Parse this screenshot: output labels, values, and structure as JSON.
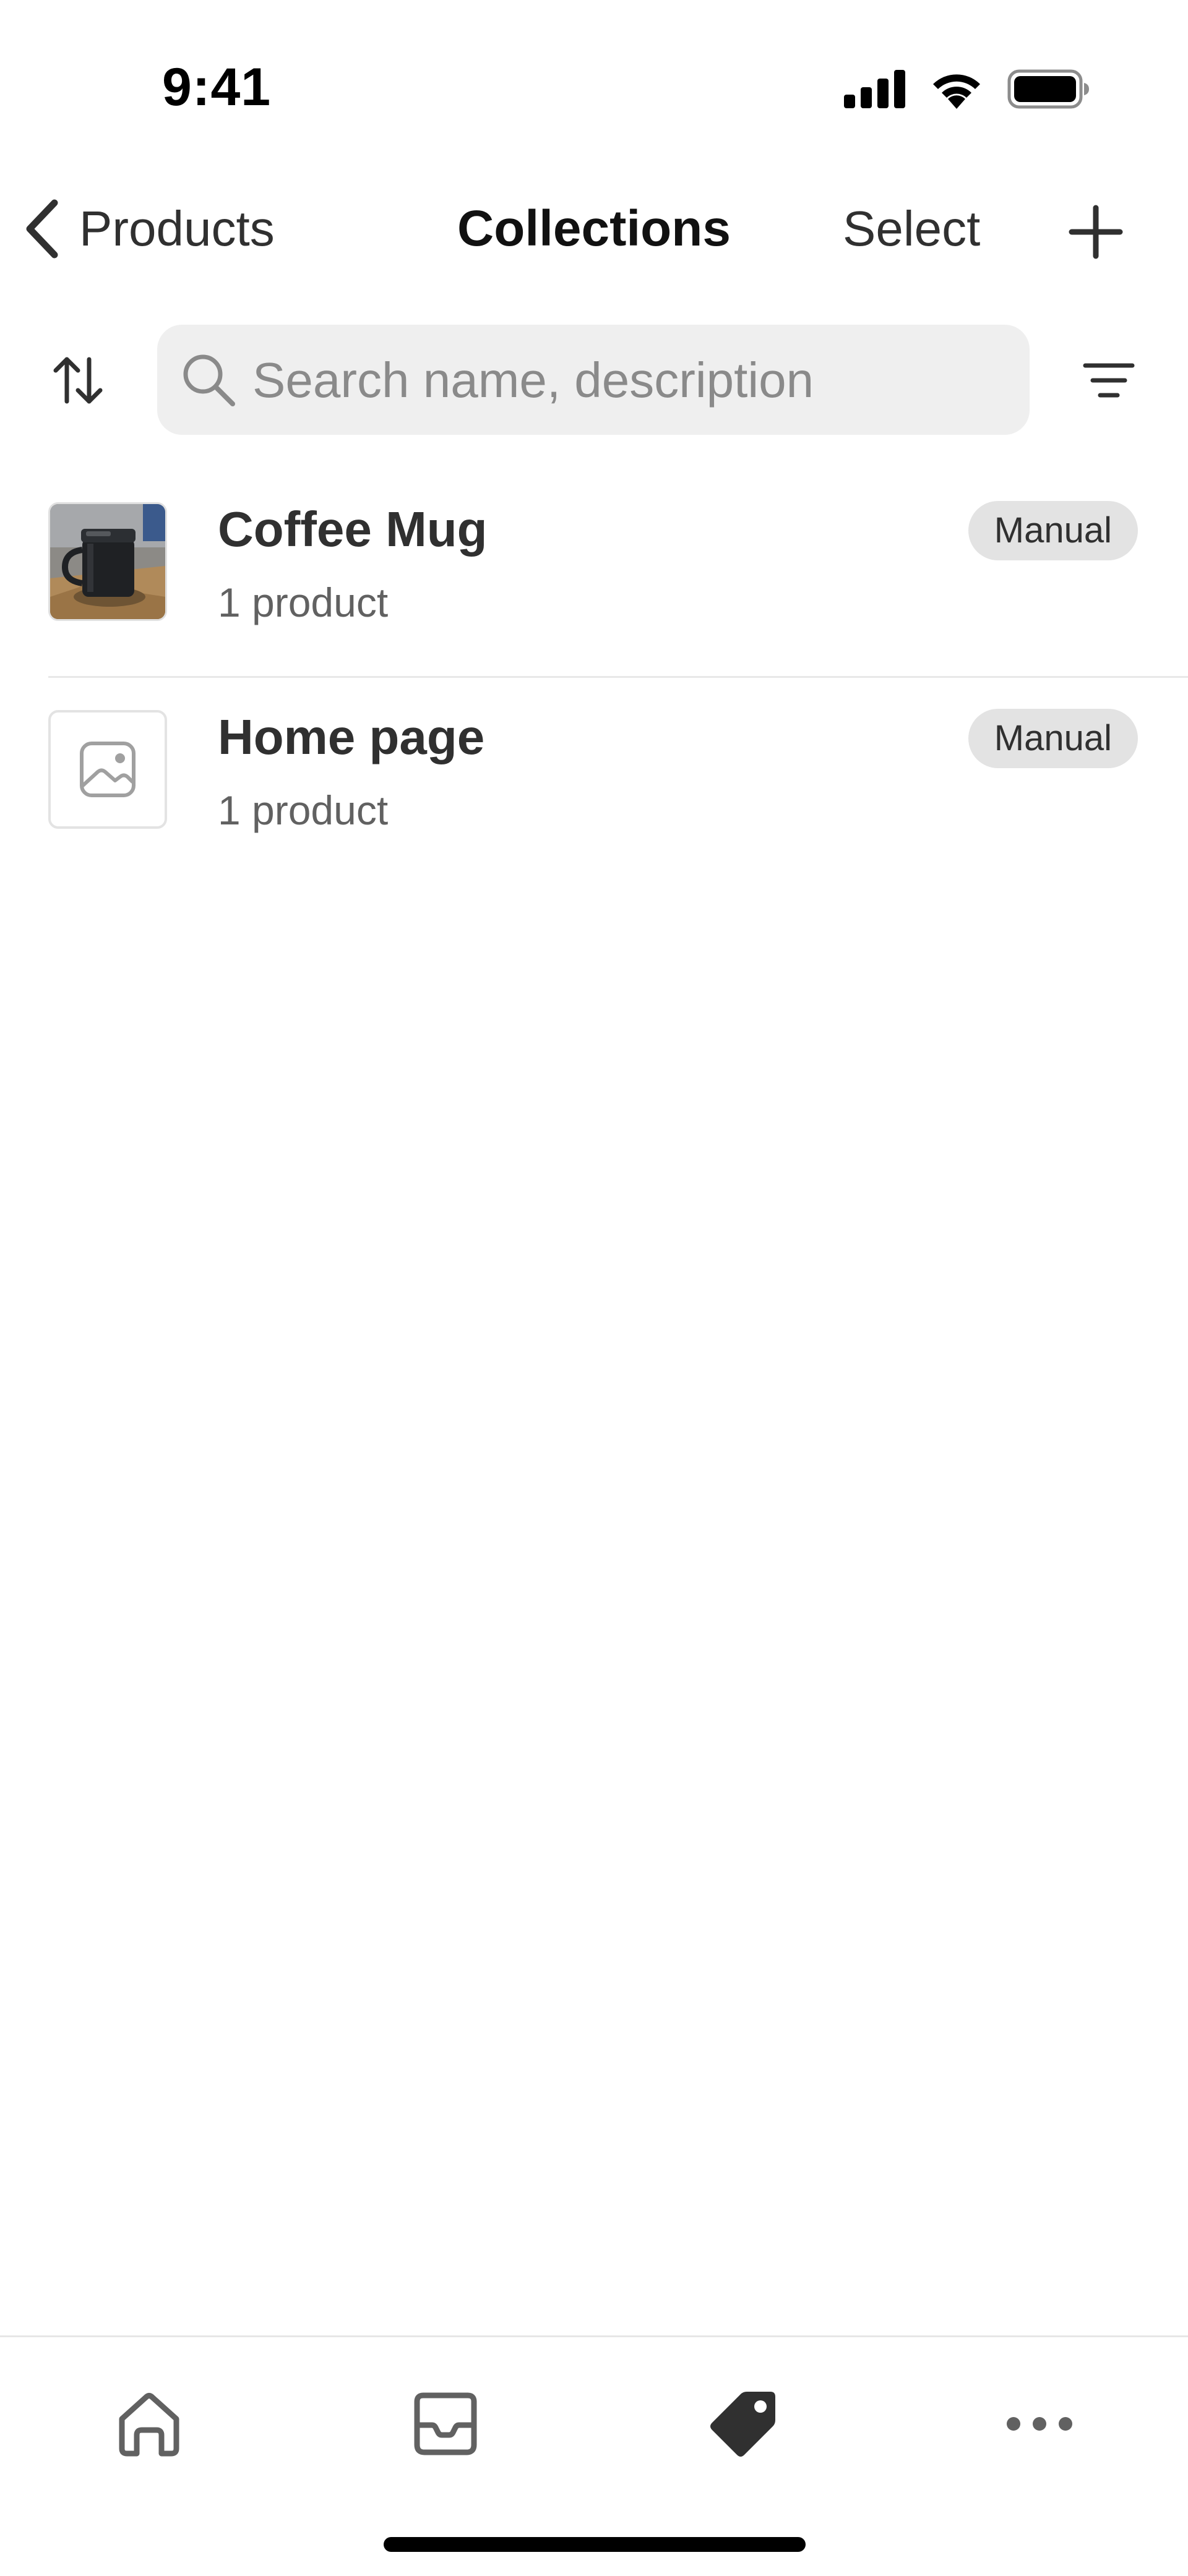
{
  "status_bar": {
    "time": "9:41",
    "icons": [
      "cellular-signal-icon",
      "wifi-icon",
      "battery-icon"
    ]
  },
  "nav": {
    "back_label": "Products",
    "title": "Collections",
    "select_label": "Select",
    "add_icon": "plus-icon"
  },
  "search": {
    "placeholder": "Search name, description",
    "value": "",
    "sort_icon": "sort-arrows-icon",
    "filter_icon": "filter-lines-icon"
  },
  "collections": [
    {
      "title": "Coffee Mug",
      "subtitle": "1 product",
      "badge": "Manual",
      "thumbnail": "coffee-mug-photo"
    },
    {
      "title": "Home page",
      "subtitle": "1 product",
      "badge": "Manual",
      "thumbnail": "image-placeholder-icon"
    }
  ],
  "tabs": [
    {
      "name": "home",
      "icon": "home-icon",
      "active": false
    },
    {
      "name": "inbox",
      "icon": "inbox-icon",
      "active": false
    },
    {
      "name": "products",
      "icon": "tag-icon",
      "active": true
    },
    {
      "name": "more",
      "icon": "more-horizontal-icon",
      "active": false
    }
  ],
  "colors": {
    "text_primary": "#303030",
    "text_secondary": "#616161",
    "placeholder": "#8a8a8a",
    "search_bg": "#efefef",
    "badge_bg": "#e3e3e3",
    "divider": "#e8e8e8",
    "icon_inactive": "#616161",
    "icon_active": "#303030"
  }
}
